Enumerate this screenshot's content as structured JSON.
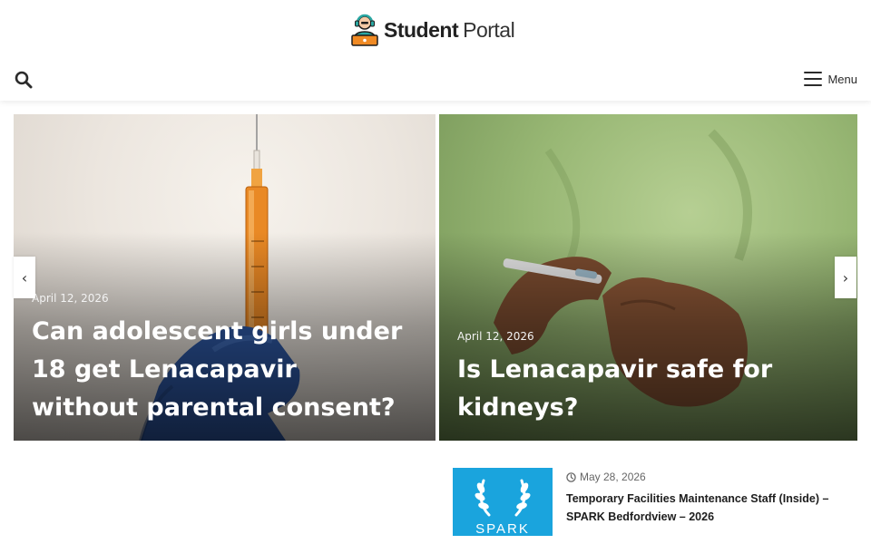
{
  "header": {
    "logo_bold": "Student",
    "logo_light": "Portal",
    "menu_label": "Menu"
  },
  "slider": {
    "slides": [
      {
        "date": "April 12, 2026",
        "title": "Can adolescent girls under 18 get Lenacapavir without parental consent?"
      },
      {
        "date": "April 12, 2026",
        "title": "Is Lenacapavir safe for kidneys?"
      }
    ],
    "prev_glyph": "‹",
    "next_glyph": "›"
  },
  "posts": [
    {
      "date": "May 28, 2026",
      "title": "Temporary Facilities Maintenance Staff (Inside) – SPARK Bedfordview – 2026",
      "thumb_text": "SPARK"
    }
  ],
  "colors": {
    "thumb_bg": "#1aa4dd",
    "logo_accent": "#f08a24",
    "logo_teal": "#2aa7a2"
  }
}
